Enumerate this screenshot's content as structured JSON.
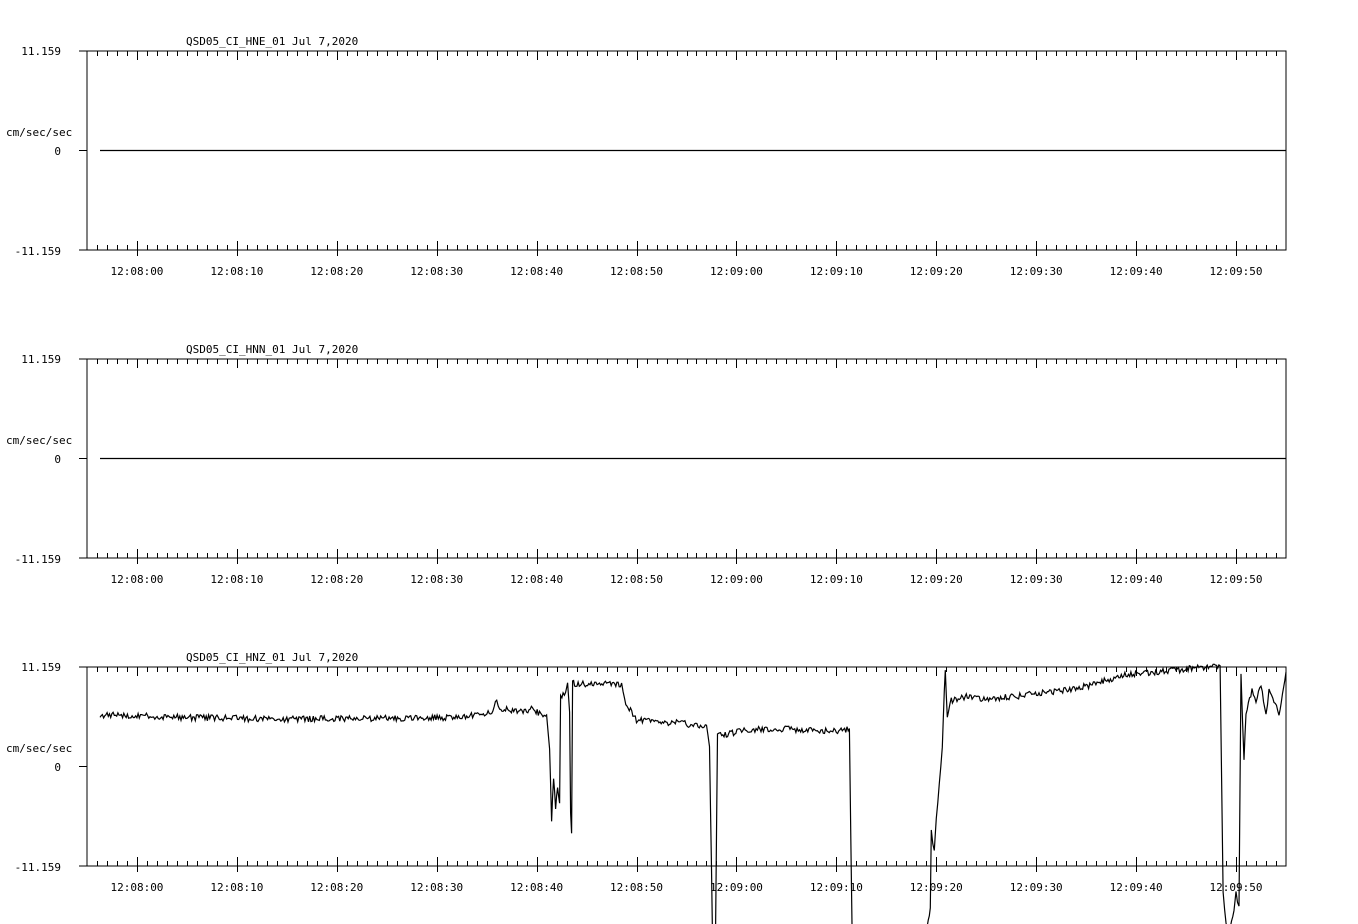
{
  "chart_data": [
    {
      "type": "line",
      "title": "QSD05_CI_HNE_01  Jul 7,2020",
      "ylabel": "cm/sec/sec",
      "yticks": [
        "11.159",
        "0",
        "-11.159"
      ],
      "ylim": [
        -11.159,
        11.159
      ],
      "xlim_seconds_after_12_07_55": [
        0,
        120
      ],
      "xticks": [
        "12:08:00",
        "12:08:10",
        "12:08:20",
        "12:08:30",
        "12:08:40",
        "12:08:50",
        "12:09:00",
        "12:09:10",
        "12:09:20",
        "12:09:30",
        "12:09:40",
        "12:09:50"
      ],
      "series": [
        {
          "values": [
            [
              1.3,
              0
            ],
            [
              120,
              0
            ]
          ]
        }
      ]
    },
    {
      "type": "line",
      "title": "QSD05_CI_HNN_01  Jul 7,2020",
      "ylabel": "cm/sec/sec",
      "yticks": [
        "11.159",
        "0",
        "-11.159"
      ],
      "ylim": [
        -11.159,
        11.159
      ],
      "xlim_seconds_after_12_07_55": [
        0,
        120
      ],
      "xticks": [
        "12:08:00",
        "12:08:10",
        "12:08:20",
        "12:08:30",
        "12:08:40",
        "12:08:50",
        "12:09:00",
        "12:09:10",
        "12:09:20",
        "12:09:30",
        "12:09:40",
        "12:09:50"
      ],
      "series": [
        {
          "values": [
            [
              1.3,
              0
            ],
            [
              120,
              0
            ]
          ]
        }
      ]
    },
    {
      "type": "line",
      "title": "QSD05_CI_HNZ_01  Jul 7,2020",
      "ylabel": "cm/sec/sec",
      "yticks": [
        "11.159",
        "0",
        "-11.159"
      ],
      "ylim": [
        -11.159,
        11.159
      ],
      "xlim_seconds_after_12_07_55": [
        0,
        120
      ],
      "xticks": [
        "12:08:00",
        "12:08:10",
        "12:08:20",
        "12:08:30",
        "12:08:40",
        "12:08:50",
        "12:09:00",
        "12:09:10",
        "12:09:20",
        "12:09:30",
        "12:09:40",
        "12:09:50"
      ],
      "series": [
        {
          "noise": 0.35,
          "values": [
            [
              1.3,
              5.8
            ],
            [
              10,
              5.5
            ],
            [
              20,
              5.3
            ],
            [
              30,
              5.4
            ],
            [
              36,
              5.5
            ],
            [
              38,
              5.7
            ],
            [
              40.5,
              6.0
            ],
            [
              41,
              7.6
            ],
            [
              41.3,
              6.6
            ],
            [
              42,
              6.4
            ],
            [
              44,
              6.2
            ],
            [
              44.6,
              6.6
            ],
            [
              45.4,
              5.8
            ],
            [
              46,
              5.5
            ],
            [
              46.3,
              2.0
            ],
            [
              46.5,
              -5.8
            ],
            [
              46.7,
              -1.5
            ],
            [
              46.9,
              -4.5
            ],
            [
              47.1,
              -2.5
            ],
            [
              47.3,
              -4.0
            ],
            [
              47.4,
              8.0
            ],
            [
              47.9,
              8.0
            ],
            [
              48.1,
              9.5
            ],
            [
              48.3,
              6.0
            ],
            [
              48.4,
              -5.0
            ],
            [
              48.5,
              -7.3
            ],
            [
              48.6,
              9.6
            ],
            [
              48.8,
              9.2
            ],
            [
              52,
              9.4
            ],
            [
              53.5,
              9.2
            ],
            [
              53.8,
              7.4
            ],
            [
              55,
              5.2
            ],
            [
              57,
              5.0
            ],
            [
              59,
              4.9
            ],
            [
              62,
              4.5
            ],
            [
              62.3,
              2.5
            ],
            [
              62.6,
              -18.8
            ],
            [
              62.9,
              -19.2
            ],
            [
              63.1,
              3.8
            ],
            [
              63.4,
              3.5
            ],
            [
              66,
              4.1
            ],
            [
              70,
              4.2
            ],
            [
              75,
              4.0
            ],
            [
              76.3,
              4.2
            ],
            [
              76.6,
              -21.0
            ],
            [
              78,
              -21.0
            ],
            [
              80,
              -20.3
            ],
            [
              82,
              -19.5
            ],
            [
              84,
              -18.8
            ],
            [
              84.2,
              -17.0
            ],
            [
              84.4,
              -16.0
            ],
            [
              84.5,
              -7.2
            ],
            [
              84.8,
              -9.5
            ],
            [
              85,
              -5.5
            ],
            [
              85.3,
              -2.0
            ],
            [
              85.6,
              2.5
            ],
            [
              85.9,
              11.0
            ],
            [
              86.1,
              5.5
            ],
            [
              86.5,
              7.4
            ],
            [
              88,
              7.8
            ],
            [
              90,
              7.6
            ],
            [
              93,
              7.9
            ],
            [
              96,
              8.3
            ],
            [
              98,
              8.6
            ],
            [
              100,
              9.0
            ],
            [
              104,
              10.3
            ],
            [
              109,
              10.8
            ],
            [
              112,
              11.2
            ],
            [
              113.4,
              11.4
            ],
            [
              113.7,
              -14.0
            ],
            [
              114,
              -17.5
            ],
            [
              114.3,
              -19.0
            ],
            [
              114.8,
              -16.0
            ],
            [
              115,
              -14.0
            ],
            [
              115.3,
              -16.0
            ],
            [
              115.5,
              10.5
            ],
            [
              115.8,
              0.5
            ],
            [
              116,
              6.0
            ],
            [
              116.6,
              8.6
            ],
            [
              117,
              7.5
            ],
            [
              117.5,
              9.0
            ],
            [
              118,
              6.0
            ],
            [
              118.3,
              8.4
            ],
            [
              119.3,
              6.0
            ],
            [
              120,
              10.6
            ]
          ]
        }
      ]
    }
  ]
}
